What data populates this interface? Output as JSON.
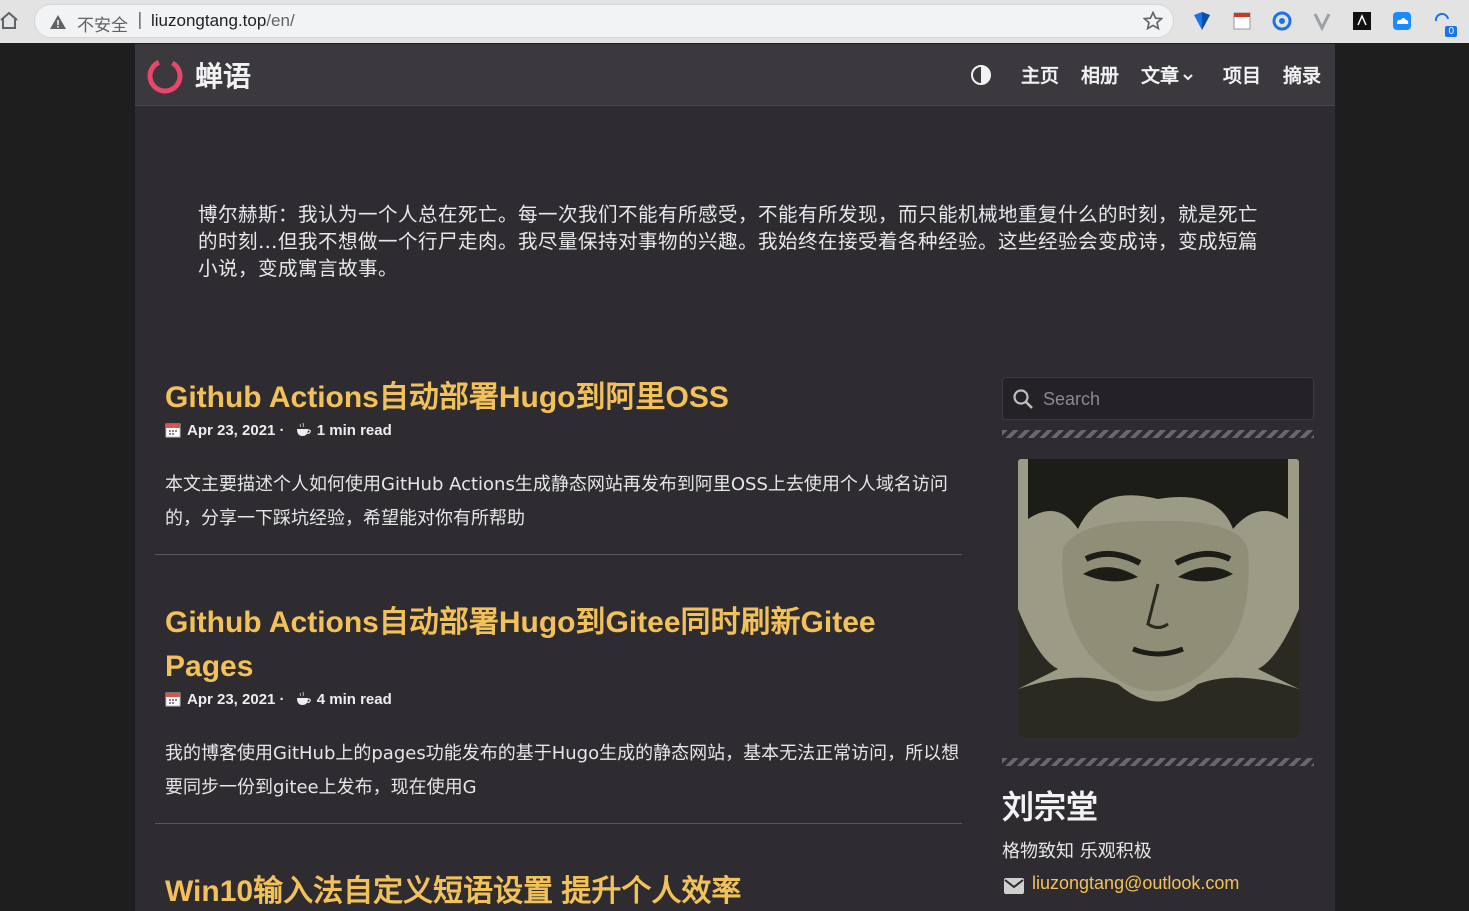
{
  "browser": {
    "security_label": "不安全",
    "separator": "|",
    "url_host": "liuzongtang.top",
    "url_path": "/en/",
    "extension_badge": "0"
  },
  "site": {
    "logo_text": "蝉语",
    "nav": [
      {
        "label": "主页"
      },
      {
        "label": "相册"
      },
      {
        "label": "文章"
      },
      {
        "label": "项目"
      },
      {
        "label": "摘录"
      }
    ],
    "quote": "博尔赫斯：我认为一个人总在死亡。每一次我们不能有所感受，不能有所发现，而只能机械地重复什么的时刻，就是死亡的时刻…但我不想做一个行尸走肉。我尽量保持对事物的兴趣。我始终在接受着各种经验。这些经验会变成诗，变成短篇小说，变成寓言故事。",
    "posts": [
      {
        "title": "Github Actions自动部署Hugo到阿里OSS",
        "date": "Apr 23, 2021 ·",
        "read_time": "1 min read",
        "summary": "本文主要描述个人如何使用GitHub Actions生成静态网站再发布到阿里OSS上去使用个人域名访问的，分享一下踩坑经验，希望能对你有所帮助"
      },
      {
        "title": "Github Actions自动部署Hugo到Gitee同时刷新Gitee Pages",
        "date": "Apr 23, 2021 ·",
        "read_time": "4 min read",
        "summary": "我的博客使用GitHub上的pages功能发布的基于Hugo生成的静态网站，基本无法正常访问，所以想要同步一份到gitee上发布，现在使用G"
      },
      {
        "title": "Win10输入法自定义短语设置 提升个人效率"
      }
    ],
    "sidebar": {
      "search_placeholder": "Search",
      "author_name": "刘宗堂",
      "author_bio": "格物致知 乐观积极",
      "author_email": "liuzongtang@outlook.com"
    }
  },
  "colors": {
    "accent": "#f3c15a",
    "logo_ring": "#e8466b",
    "page_bg": "#2e2c30",
    "navbar_bg": "#3b393d"
  },
  "icons": [
    "home-icon",
    "warning-icon",
    "star-icon",
    "calendar-icon",
    "coffee-icon",
    "search-icon",
    "mail-icon",
    "theme-toggle-icon",
    "chevron-down-icon"
  ]
}
